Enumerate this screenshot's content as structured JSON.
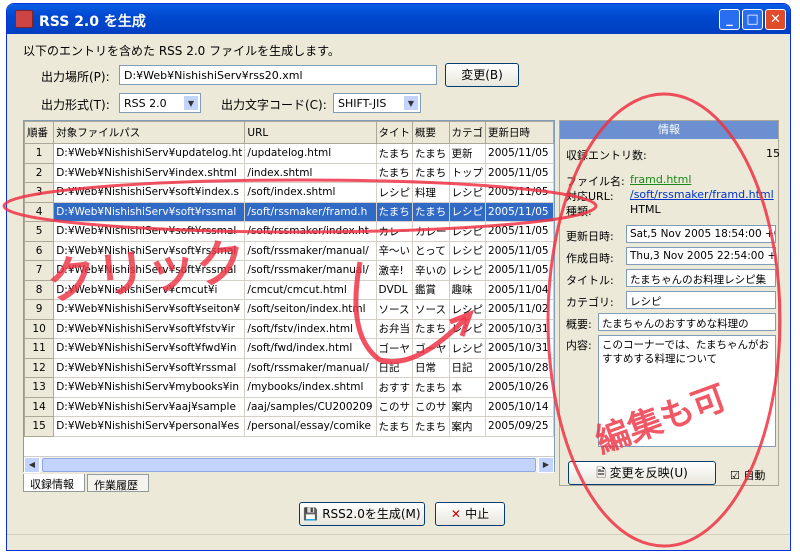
{
  "window": {
    "title": "RSS 2.0 を生成",
    "minimize_icon": "minimize-icon",
    "maximize_icon": "maximize-icon",
    "close_icon": "close-icon"
  },
  "intro_text": "以下のエントリを含めた RSS 2.0 ファイルを生成します。",
  "output_path": {
    "label": "出力場所(P):",
    "value": "D:¥Web¥NishishiServ¥rss20.xml",
    "change_button": "変更(B)"
  },
  "format": {
    "label": "出力形式(T):",
    "value": "RSS 2.0",
    "encoding_label": "出力文字コード(C):",
    "encoding_value": "SHIFT-JIS"
  },
  "table": {
    "columns": [
      "順番",
      "対象ファイルパス",
      "URL",
      "タイト",
      "概要",
      "カテゴ",
      "更新日時"
    ],
    "rows": [
      {
        "num": "1",
        "path": "D:¥Web¥NishishiServ¥updatelog.ht",
        "url": "/updatelog.html",
        "title": "たまち",
        "summary": "たまち",
        "category": "更新",
        "date": "2005/11/05"
      },
      {
        "num": "2",
        "path": "D:¥Web¥NishishiServ¥index.shtml",
        "url": "/index.shtml",
        "title": "たまち",
        "summary": "たまち",
        "category": "トップ",
        "date": "2005/11/05"
      },
      {
        "num": "3",
        "path": "D:¥Web¥NishishiServ¥soft¥index.s",
        "url": "/soft/index.shtml",
        "title": "レシピ",
        "summary": "料理",
        "category": "レシピ",
        "date": "2005/11/05"
      },
      {
        "num": "4",
        "path": "D:¥Web¥NishishiServ¥soft¥rssmal",
        "url": "/soft/rssmaker/framd.h",
        "title": "たまち",
        "summary": "たまち",
        "category": "レシピ",
        "date": "2005/11/05"
      },
      {
        "num": "5",
        "path": "D:¥Web¥NishishiServ¥soft¥rssmal",
        "url": "/soft/rssmaker/index.ht",
        "title": "カレー",
        "summary": "カレー",
        "category": "レシピ",
        "date": "2005/11/05"
      },
      {
        "num": "6",
        "path": "D:¥Web¥NishishiServ¥soft¥rssmal",
        "url": "/soft/rssmaker/manual/",
        "title": "辛〜い",
        "summary": "とって",
        "category": "レシピ",
        "date": "2005/11/05"
      },
      {
        "num": "7",
        "path": "D:¥Web¥NishishiServ¥soft¥rssmal",
        "url": "/soft/rssmaker/manual/",
        "title": "激辛!",
        "summary": "辛いの",
        "category": "レシピ",
        "date": "2005/11/05"
      },
      {
        "num": "8",
        "path": "D:¥Web¥NishishiServ¥cmcut¥i",
        "url": "/cmcut/cmcut.html",
        "title": "DVDL",
        "summary": "鑑賞",
        "category": "趣味",
        "date": "2005/11/04"
      },
      {
        "num": "9",
        "path": "D:¥Web¥NishishiServ¥soft¥seiton¥",
        "url": "/soft/seiton/index.html",
        "title": "ソース",
        "summary": "ソース",
        "category": "レシピ",
        "date": "2005/11/02"
      },
      {
        "num": "10",
        "path": "D:¥Web¥NishishiServ¥soft¥fstv¥ir",
        "url": "/soft/fstv/index.html",
        "title": "お弁当",
        "summary": "たまち",
        "category": "レシピ",
        "date": "2005/10/31"
      },
      {
        "num": "11",
        "path": "D:¥Web¥NishishiServ¥soft¥fwd¥in",
        "url": "/soft/fwd/index.html",
        "title": "ゴーヤ",
        "summary": "ゴーヤ",
        "category": "レシピ",
        "date": "2005/10/31"
      },
      {
        "num": "12",
        "path": "D:¥Web¥NishishiServ¥soft¥rssmal",
        "url": "/soft/rssmaker/manual/",
        "title": "日記",
        "summary": "日常",
        "category": "日記",
        "date": "2005/10/28"
      },
      {
        "num": "13",
        "path": "D:¥Web¥NishishiServ¥mybooks¥in",
        "url": "/mybooks/index.shtml",
        "title": "おすす",
        "summary": "たまち",
        "category": "本",
        "date": "2005/10/26"
      },
      {
        "num": "14",
        "path": "D:¥Web¥NishishiServ¥aaj¥sample",
        "url": "/aaj/samples/CU200209",
        "title": "このサ",
        "summary": "このサ",
        "category": "案内",
        "date": "2005/10/14"
      },
      {
        "num": "15",
        "path": "D:¥Web¥NishishiServ¥personal¥es",
        "url": "/personal/essay/comike",
        "title": "たまち",
        "summary": "たまち",
        "category": "案内",
        "date": "2005/09/25"
      }
    ],
    "selected_row": "4"
  },
  "tabs": [
    "収録情報",
    "作業履歴"
  ],
  "info_panel": {
    "header": "情報",
    "entry_count_label": "収録エントリ数:",
    "entry_count": "15",
    "file_label": "ファイル名:",
    "file_value": "framd.html",
    "url_label": "対応URL:",
    "url_value": "/soft/rssmaker/framd.html",
    "type_label": "種類:",
    "type_value": "HTML",
    "updated_label": "更新日時:",
    "updated_value": "Sat,5 Nov 2005 18:54:00 +0",
    "created_label": "作成日時:",
    "created_value": "Thu,3 Nov 2005 22:54:00 +0",
    "title_label": "タイトル:",
    "title_value": "たまちゃんのお料理レシピ集",
    "category_label": "カテゴリ:",
    "category_value": "レシピ",
    "summary_label": "概要:",
    "summary_value": "たまちゃんのおすすめな料理の",
    "content_label": "内容:",
    "content_value": "このコーナーでは、たまちゃんがおすすめする料理について",
    "apply_button": "変更を反映(U)",
    "auto_label": "自動"
  },
  "buttons": {
    "generate": "RSS2.0を生成(M)",
    "cancel": "中止"
  },
  "annotations": {
    "click_text": "クリック",
    "edit_text": "編集も可",
    "color": "#ee3344"
  }
}
